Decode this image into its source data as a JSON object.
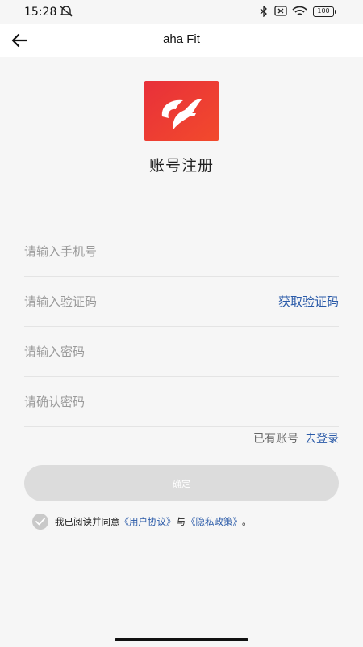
{
  "status_bar": {
    "time": "15:28",
    "battery": "100"
  },
  "app_bar": {
    "title": "aha Fit"
  },
  "page": {
    "title": "账号注册"
  },
  "form": {
    "phone_placeholder": "请输入手机号",
    "code_placeholder": "请输入验证码",
    "get_code_label": "获取验证码",
    "password_placeholder": "请输入密码",
    "confirm_password_placeholder": "请确认密码"
  },
  "login_prompt": {
    "text": "已有账号",
    "link": "去登录"
  },
  "confirm_label": "确定",
  "agreement": {
    "prefix": "我已阅读并同意",
    "user_agreement": "《用户协议》",
    "and": "与",
    "privacy_policy": "《隐私政策》",
    "suffix": "。",
    "checked": true
  },
  "colors": {
    "link": "#2a5aa8",
    "logo_gradient_start": "#e8303a",
    "logo_gradient_end": "#f24a2c",
    "button_disabled": "#dcdcdc"
  },
  "icons": [
    "back-arrow-icon",
    "mute-icon",
    "bluetooth-icon",
    "sim-off-icon",
    "wifi-icon",
    "battery-icon",
    "app-logo",
    "check-icon"
  ]
}
